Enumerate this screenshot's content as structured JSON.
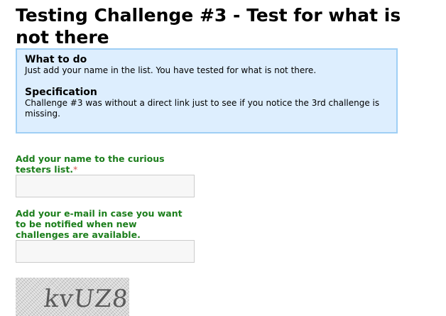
{
  "page": {
    "title": "Testing Challenge #3 - Test for what is not there"
  },
  "info_box": {
    "what_to_do_heading": "What to do",
    "what_to_do_text": "Just add your name in the list. You have tested for what is not there.",
    "specification_heading": "Specification",
    "specification_text": "Challenge #3 was without a direct link just to see if you notice the 3rd challenge is missing."
  },
  "form": {
    "name_label": "Add your name to the curious testers list.",
    "name_required_marker": "*",
    "name_value": "",
    "email_label": "Add your e-mail in case you want to be notified when new challenges are available.",
    "email_value": "",
    "captcha_text": "kvUZ8"
  },
  "colors": {
    "info_background": "#ddeefe",
    "info_border": "#9fcff5",
    "label_green": "#1b7e1b",
    "required_red": "#d9534f"
  }
}
